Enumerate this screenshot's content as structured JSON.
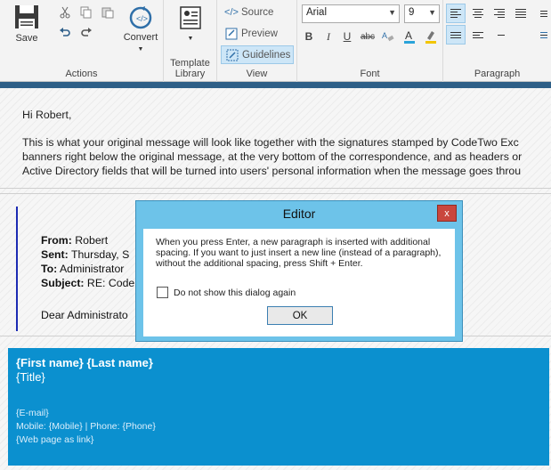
{
  "ribbon": {
    "actions": {
      "save_label": "Save",
      "convert_label": "Convert",
      "group_label": "Actions",
      "icons": [
        "scissors-icon",
        "copy-icon",
        "paste-icon",
        "undo-icon",
        "redo-icon"
      ]
    },
    "template": {
      "line1": "Template",
      "line2": "Library"
    },
    "view": {
      "source_label": "Source",
      "preview_label": "Preview",
      "guidelines_label": "Guidelines",
      "group_label": "View"
    },
    "font": {
      "family": "Arial",
      "size": "9",
      "bold": "B",
      "italic": "I",
      "underline": "U",
      "strike": "abc",
      "group_label": "Font"
    },
    "paragraph": {
      "group_label": "Paragraph"
    }
  },
  "message": {
    "greeting": "Hi Robert,",
    "line1": "This is what your original message will look like together with the signatures stamped by CodeTwo Exc",
    "line2": "banners right below the original message, at the very bottom of the correspondence, and as headers or",
    "line3": "Active Directory fields that will be turned into users' personal information when the message goes throu"
  },
  "quote": {
    "from_label": "From:",
    "from_value": " Robert",
    "sent_label": "Sent:",
    "sent_value": " Thursday, S",
    "to_label": "To:",
    "to_value": " Administrator",
    "subject_label": "Subject:",
    "subject_value": " RE: Code",
    "salutation": "Dear Administrato"
  },
  "signature": {
    "name": "{First name} {Last name}",
    "title": "{Title}",
    "email": "{E-mail}",
    "phones": "Mobile:  {Mobile} | Phone: {Phone}",
    "web": "{Web page as link}"
  },
  "dialog": {
    "title": "Editor",
    "close_glyph": "x",
    "message": "When you press Enter, a new paragraph is inserted with additional spacing. If you want to just insert a new line (instead of a paragraph), without the additional spacing, press Shift + Enter.",
    "checkbox_label": "Do not show this dialog again",
    "ok_label": "OK"
  },
  "colors": {
    "ribbon_bg": "#f3f3f3",
    "header_bar": "#2e5f87",
    "signature_bg": "#0b90cf",
    "dialog_frame": "#6dc3e9",
    "close_button": "#c9463d",
    "quote_border": "#1c2bb3"
  }
}
